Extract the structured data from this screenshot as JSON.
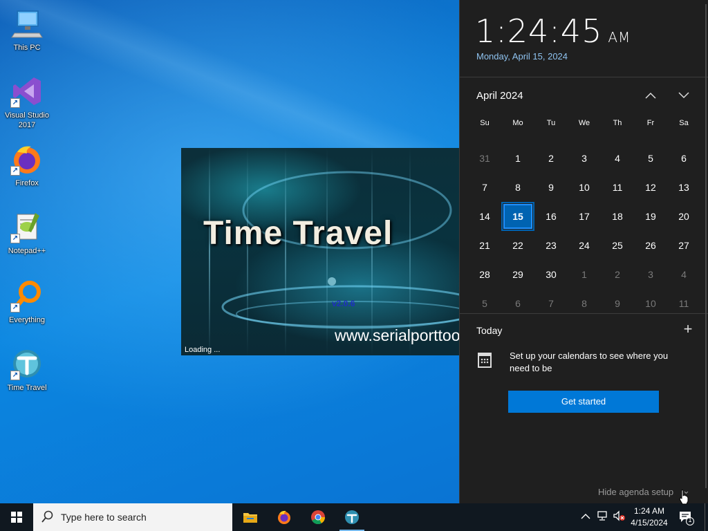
{
  "desktop_icons": [
    {
      "label": "This PC",
      "icon": "computer-icon"
    },
    {
      "label": "Visual Studio\n2017",
      "icon": "visual-studio-icon"
    },
    {
      "label": "Firefox",
      "icon": "firefox-icon"
    },
    {
      "label": "Notepad++",
      "icon": "notepad-plus-plus-icon"
    },
    {
      "label": "Everything",
      "icon": "everything-search-icon"
    },
    {
      "label": "Time Travel",
      "icon": "time-travel-icon"
    }
  ],
  "splash": {
    "title": "Time Travel",
    "version": "v2.0.6",
    "url": "www.serialporttool.com",
    "status": "Loading ..."
  },
  "flyout": {
    "time": "1:24:45",
    "ampm": "AM",
    "long_date": "Monday, April 15, 2024",
    "month_title": "April 2024",
    "prev_icon": "chevron-up-icon",
    "next_icon": "chevron-down-icon",
    "weekdays": [
      "Su",
      "Mo",
      "Tu",
      "We",
      "Th",
      "Fr",
      "Sa"
    ],
    "days": [
      {
        "n": "31",
        "dim": true
      },
      {
        "n": "1"
      },
      {
        "n": "2"
      },
      {
        "n": "3"
      },
      {
        "n": "4"
      },
      {
        "n": "5"
      },
      {
        "n": "6"
      },
      {
        "n": "7"
      },
      {
        "n": "8"
      },
      {
        "n": "9"
      },
      {
        "n": "10"
      },
      {
        "n": "11"
      },
      {
        "n": "12"
      },
      {
        "n": "13"
      },
      {
        "n": "14"
      },
      {
        "n": "15",
        "today": true
      },
      {
        "n": "16"
      },
      {
        "n": "17"
      },
      {
        "n": "18"
      },
      {
        "n": "19"
      },
      {
        "n": "20"
      },
      {
        "n": "21"
      },
      {
        "n": "22"
      },
      {
        "n": "23"
      },
      {
        "n": "24"
      },
      {
        "n": "25"
      },
      {
        "n": "26"
      },
      {
        "n": "27"
      },
      {
        "n": "28"
      },
      {
        "n": "29"
      },
      {
        "n": "30"
      },
      {
        "n": "1",
        "dim": true
      },
      {
        "n": "2",
        "dim": true
      },
      {
        "n": "3",
        "dim": true
      },
      {
        "n": "4",
        "dim": true
      },
      {
        "n": "5",
        "dim": true
      },
      {
        "n": "6",
        "dim": true
      },
      {
        "n": "7",
        "dim": true
      },
      {
        "n": "8",
        "dim": true
      },
      {
        "n": "9",
        "dim": true
      },
      {
        "n": "10",
        "dim": true
      },
      {
        "n": "11",
        "dim": true
      }
    ],
    "agenda_title": "Today",
    "add_icon": "plus-icon",
    "setup_text": "Set up your calendars to see where you need to be",
    "get_started_label": "Get started",
    "hide_agenda_label": "Hide agenda setup",
    "today_color": "#0063b1",
    "button_color": "#0078d7"
  },
  "taskbar": {
    "search_placeholder": "Type here to search",
    "apps": [
      {
        "name": "file-explorer-icon",
        "active": false
      },
      {
        "name": "firefox-icon",
        "active": false
      },
      {
        "name": "chrome-icon",
        "active": false
      },
      {
        "name": "time-travel-icon",
        "active": true
      }
    ],
    "tray_time": "1:24 AM",
    "tray_date": "4/15/2024",
    "notification_count": "1"
  }
}
